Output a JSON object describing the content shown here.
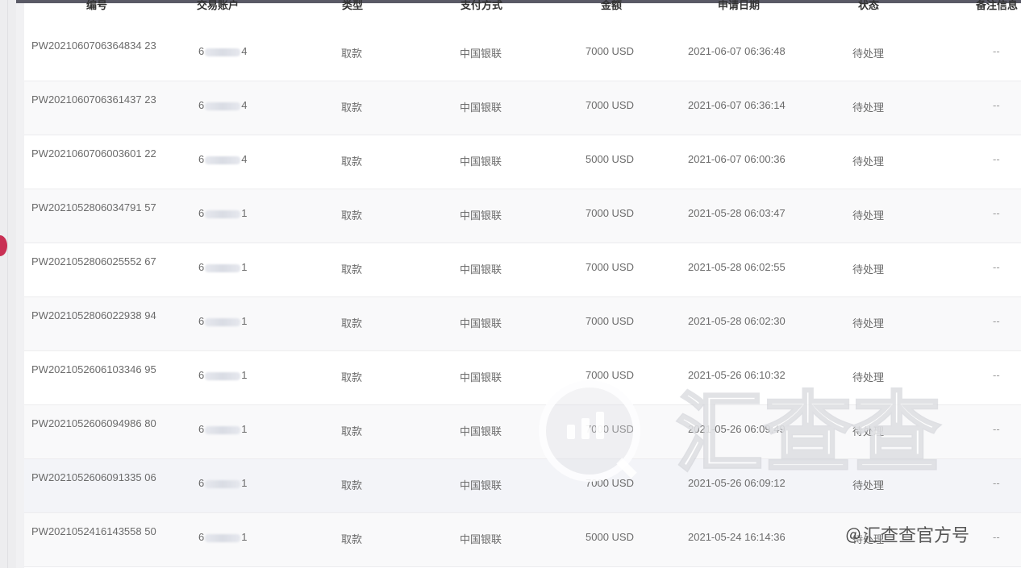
{
  "table": {
    "columns": [
      {
        "name": "col-order-no",
        "label": "编号"
      },
      {
        "name": "col-account",
        "label": "交易账户"
      },
      {
        "name": "col-type",
        "label": "类型"
      },
      {
        "name": "col-channel",
        "label": "支付方式"
      },
      {
        "name": "col-amount",
        "label": "金额"
      },
      {
        "name": "col-time",
        "label": "申请日期"
      },
      {
        "name": "col-status",
        "label": "状态"
      },
      {
        "name": "col-remark",
        "label": "备注信息"
      }
    ],
    "rows": [
      {
        "order": "PW2021060706364834 23",
        "acct_start": "6",
        "acct_end": "4",
        "type": "取款",
        "channel": "中国银联",
        "amount": "7000 USD",
        "time": "2021-06-07 06:36:48",
        "status": "待处理",
        "remark": "--"
      },
      {
        "order": "PW2021060706361437 23",
        "acct_start": "6",
        "acct_end": "4",
        "type": "取款",
        "channel": "中国银联",
        "amount": "7000 USD",
        "time": "2021-06-07 06:36:14",
        "status": "待处理",
        "remark": "--"
      },
      {
        "order": "PW2021060706003601 22",
        "acct_start": "6",
        "acct_end": "4",
        "type": "取款",
        "channel": "中国银联",
        "amount": "5000 USD",
        "time": "2021-06-07 06:00:36",
        "status": "待处理",
        "remark": "--"
      },
      {
        "order": "PW2021052806034791 57",
        "acct_start": "6",
        "acct_end": "1",
        "type": "取款",
        "channel": "中国银联",
        "amount": "7000 USD",
        "time": "2021-05-28 06:03:47",
        "status": "待处理",
        "remark": "--"
      },
      {
        "order": "PW2021052806025552 67",
        "acct_start": "6",
        "acct_end": "1",
        "type": "取款",
        "channel": "中国银联",
        "amount": "7000 USD",
        "time": "2021-05-28 06:02:55",
        "status": "待处理",
        "remark": "--"
      },
      {
        "order": "PW2021052806022938 94",
        "acct_start": "6",
        "acct_end": "1",
        "type": "取款",
        "channel": "中国银联",
        "amount": "7000 USD",
        "time": "2021-05-28 06:02:30",
        "status": "待处理",
        "remark": "--"
      },
      {
        "order": "PW2021052606103346 95",
        "acct_start": "6",
        "acct_end": "1",
        "type": "取款",
        "channel": "中国银联",
        "amount": "7000 USD",
        "time": "2021-05-26 06:10:32",
        "status": "待处理",
        "remark": "--"
      },
      {
        "order": "PW2021052606094986 80",
        "acct_start": "6",
        "acct_end": "1",
        "type": "取款",
        "channel": "中国银联",
        "amount": "7000 USD",
        "time": "2021-05-26 06:09:49",
        "status": "待处理",
        "remark": "--"
      },
      {
        "order": "PW2021052606091335 06",
        "acct_start": "6",
        "acct_end": "1",
        "type": "取款",
        "channel": "中国银联",
        "amount": "7000 USD",
        "time": "2021-05-26 06:09:12",
        "status": "待处理",
        "remark": "--"
      },
      {
        "order": "PW2021052416143558 50",
        "acct_start": "6",
        "acct_end": "1",
        "type": "取款",
        "channel": "中国银联",
        "amount": "5000 USD",
        "time": "2021-05-24 16:14:36",
        "status": "待处理",
        "remark": "--"
      }
    ]
  },
  "watermark": {
    "text": "汇查查",
    "icon": "bar-chart-magnifier-icon"
  },
  "credit": {
    "icon": "at-icon",
    "text": "汇查查官方号"
  },
  "colors": {
    "top_bar": "#5a5a66",
    "side_dot": "#c93054"
  }
}
